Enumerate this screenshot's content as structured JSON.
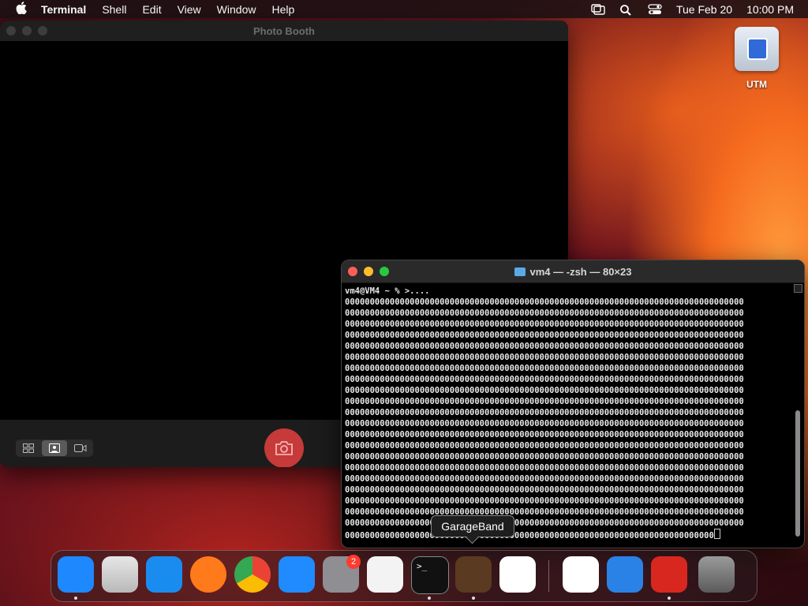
{
  "menubar": {
    "app_name": "Terminal",
    "menus": [
      "Shell",
      "Edit",
      "View",
      "Window",
      "Help"
    ],
    "date": "Tue Feb 20",
    "time": "10:00 PM"
  },
  "desktop": {
    "disk_label": "UTM"
  },
  "photobooth": {
    "title": "Photo Booth"
  },
  "terminal": {
    "title": "vm4 — -zsh — 80×23",
    "prompt_line": "vm4@VM4 ~ % >....",
    "output_line": "00000000000000000000000000000000000000000000000000000000000000000000000000000000",
    "output_line_count": 21,
    "last_line": "00000000000000000000000000000000000000000000000000000000000000000000000000"
  },
  "tooltip": {
    "text": "GarageBand"
  },
  "dock": {
    "apps": [
      {
        "name": "Finder",
        "color": "#1e88ff"
      },
      {
        "name": "Launchpad",
        "color": "#d0d0d0"
      },
      {
        "name": "Safari",
        "color": "#1a8cf0"
      },
      {
        "name": "Firefox",
        "color": "#ff7a1a"
      },
      {
        "name": "Chrome",
        "color": "#ffffff"
      },
      {
        "name": "App Store",
        "color": "#1f8bff"
      },
      {
        "name": "System Settings",
        "color": "#8e8e93"
      },
      {
        "name": "TextEdit",
        "color": "#f3f3f3"
      },
      {
        "name": "Terminal",
        "color": "#111111"
      },
      {
        "name": "GarageBand",
        "color": "#5a3a20"
      },
      {
        "name": "VS Code",
        "color": "#ffffff"
      },
      {
        "name": "Visual Studio",
        "color": "#ffffff"
      },
      {
        "name": "Weather",
        "color": "#2a82e6"
      },
      {
        "name": "Photo Booth",
        "color": "#d8271f"
      },
      {
        "name": "Trash",
        "color": "#6d6d6d"
      }
    ],
    "settings_badge": "2"
  }
}
